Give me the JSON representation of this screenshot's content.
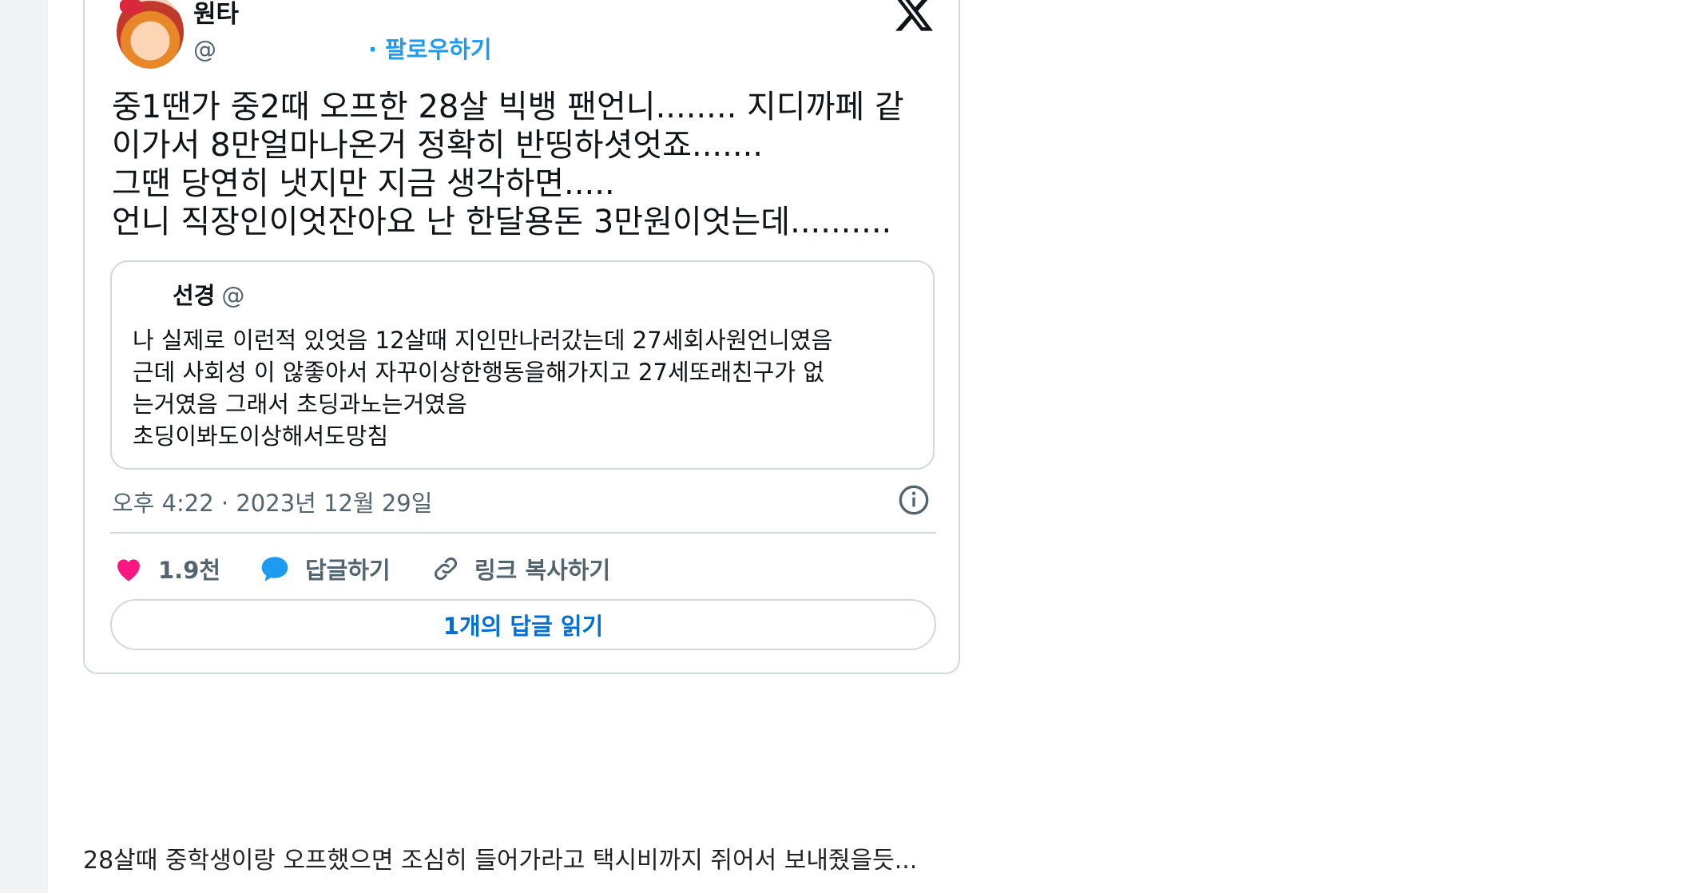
{
  "tweet": {
    "display_name": "원타",
    "handle": "@",
    "follow_label": "· 팔로우하기",
    "text": "중1땐가 중2때 오프한 28살 빅뱅 팬언니........ 지디까페 같\n이가서 8만얼마나온거 정확히 반띵하셧엇죠.......\n그땐 당연히 냇지만 지금 생각하면.....\n언니 직장인이엇잔아요 난 한달용돈 3만원이엇는데..........",
    "quote": {
      "name": "선경",
      "handle": "@",
      "text": "나 실제로 이런적 있엇음 12살때 지인만나러갔는데 27세회사원언니였음\n근데 사회성 이 않좋아서 자꾸이상한행동을해가지고 27세또래친구가 없\n는거였음 그래서 초딩과노는거였음\n초딩이봐도이상해서도망침"
    },
    "timestamp": "오후 4:22 · 2023년 12월 29일",
    "actions": {
      "like_count": "1.9천",
      "reply_label": "답글하기",
      "copy_link_label": "링크 복사하기"
    },
    "read_replies_label": "1개의 답글 읽기"
  },
  "comment": "28살때 중학생이랑 오프했으면 조심히 들어가라고 택시비까지 쥐어서 보내줬을듯..."
}
